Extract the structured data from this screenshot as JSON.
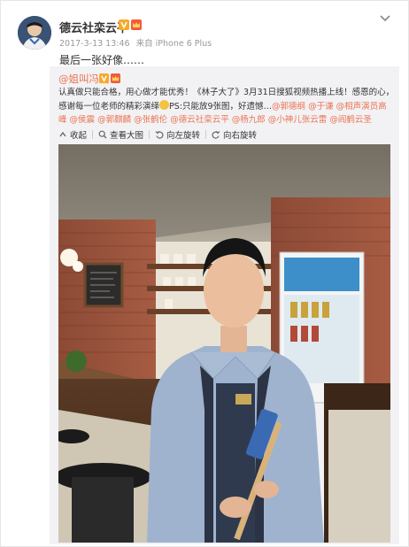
{
  "post": {
    "username": "德云社栾云平",
    "timestamp": "2017-3-13 13:46",
    "source": "来自 iPhone 6 Plus",
    "text": "最后一张好像……"
  },
  "retweet": {
    "author": "@姐叫冯娟",
    "text_part1": "认真做只能合格，用心做才能优秀！《林子大了》3月31日搜狐视频热播上线！感恩的心，感谢每一位老师的精彩演绎",
    "text_part2": "PS:只能放9张图，好遗憾…",
    "mentions": [
      "@郭德纲",
      "@于谦",
      "@相声演员高峰",
      "@侯震",
      "@郭麒麟",
      "@张鹤伦",
      "@德云社栾云平",
      "@杨九郎",
      "@小神儿张云雷",
      "@阎鹤云圣"
    ],
    "toolbar": {
      "collect": "收起",
      "view_large": "查看大图",
      "rotate_left": "向左旋转",
      "rotate_right": "向右旋转"
    }
  },
  "colors": {
    "accent": "#eb7350",
    "meta": "#999999",
    "retweet_bg": "#f2f2f5"
  },
  "icons": [
    "chevron-down-icon",
    "verified-v-icon",
    "crown-icon",
    "collapse-icon",
    "zoom-icon",
    "rotate-left-icon",
    "rotate-right-icon"
  ]
}
